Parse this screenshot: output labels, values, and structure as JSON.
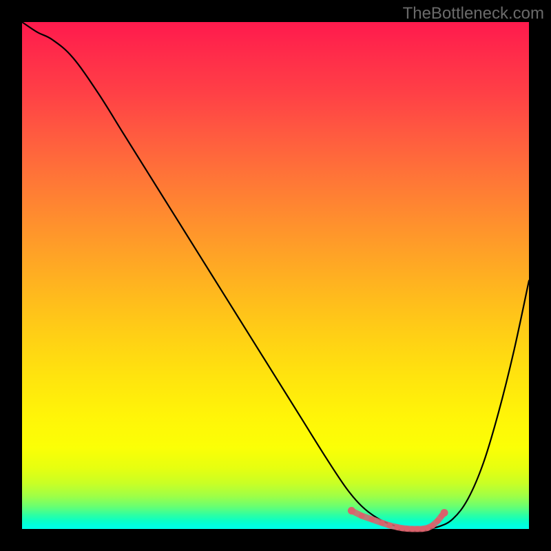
{
  "watermark": "TheBottleneck.com",
  "colors": {
    "curve": "#000000",
    "marker": "#d9626c",
    "marker_light": "#e78a90"
  },
  "chart_data": {
    "type": "line",
    "title": "",
    "xlabel": "",
    "ylabel": "",
    "xlim": [
      0,
      100
    ],
    "ylim": [
      0,
      100
    ],
    "x": [
      0,
      3,
      6,
      10,
      15,
      20,
      25,
      30,
      35,
      40,
      45,
      50,
      55,
      60,
      64,
      67,
      70,
      73,
      76,
      79,
      82,
      85,
      88,
      91,
      94,
      97,
      100
    ],
    "values": [
      100,
      98,
      96.5,
      93,
      86,
      78,
      70,
      62,
      54,
      46,
      38,
      30,
      22,
      14,
      8,
      4.5,
      2.2,
      0.8,
      0.1,
      0.0,
      0.4,
      2.0,
      6,
      13,
      23,
      35,
      49
    ],
    "optimal_marker_x": [
      65,
      67,
      69,
      71,
      72.5,
      74,
      75,
      76,
      77,
      78,
      79,
      80,
      81,
      82,
      82.8,
      83.3
    ],
    "optimal_marker_y": [
      3.6,
      2.6,
      1.9,
      1.2,
      0.7,
      0.35,
      0.15,
      0.05,
      0.0,
      0.0,
      0.02,
      0.2,
      0.7,
      1.6,
      2.6,
      3.2
    ],
    "background_gradient": "bottleneck-red-to-green"
  }
}
